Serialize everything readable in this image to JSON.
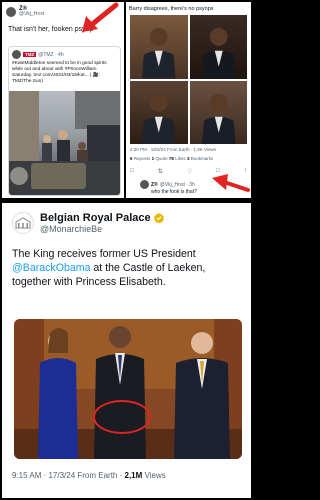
{
  "left": {
    "user": "Z®",
    "handle": "@Vkj_Host",
    "text": "That isn't her, fooken psyop",
    "quote": {
      "brand": "TMZ",
      "handle": "@TMZ · 4h",
      "text": "#KateMiddleton seemed to be in good spirits while out and about with #PrinceWilliam Saturday. tmz.com/2024/03/18/kat... | 🎥: TMZ/The Sun)"
    }
  },
  "right": {
    "top_text": "Barry disagrees, there's no psyops",
    "meta": "4:20 PM · 18/3/24 From Earth · 1,9K Views",
    "stats": {
      "reposts_num": "6",
      "reposts_label": "Reposts",
      "quotes_num": "1",
      "quotes_label": "Quote",
      "likes_num": "78",
      "likes_label": "Likes",
      "bookmarks_num": "3",
      "bookmarks_label": "Bookmarks"
    },
    "reply": {
      "user": "Z®",
      "handle": "@Vkj_Host · 3h",
      "text": "who the fook is that?"
    }
  },
  "bottom": {
    "name": "Belgian Royal Palace",
    "handle": "@MonarchieBe",
    "body_1": "The King receives former US President",
    "mention": "@BarackObama",
    "body_2": " at the Castle of Laeken, together with Princess Elisabeth.",
    "time": "9:15 AM · 17/3/24 From Earth · ",
    "views_num": "2,1M",
    "views_label": " Views"
  },
  "colors": {
    "link": "#1d9bf0",
    "arrow": "#e02424",
    "verified_gold": "#e8b500",
    "muted": "#536471"
  }
}
